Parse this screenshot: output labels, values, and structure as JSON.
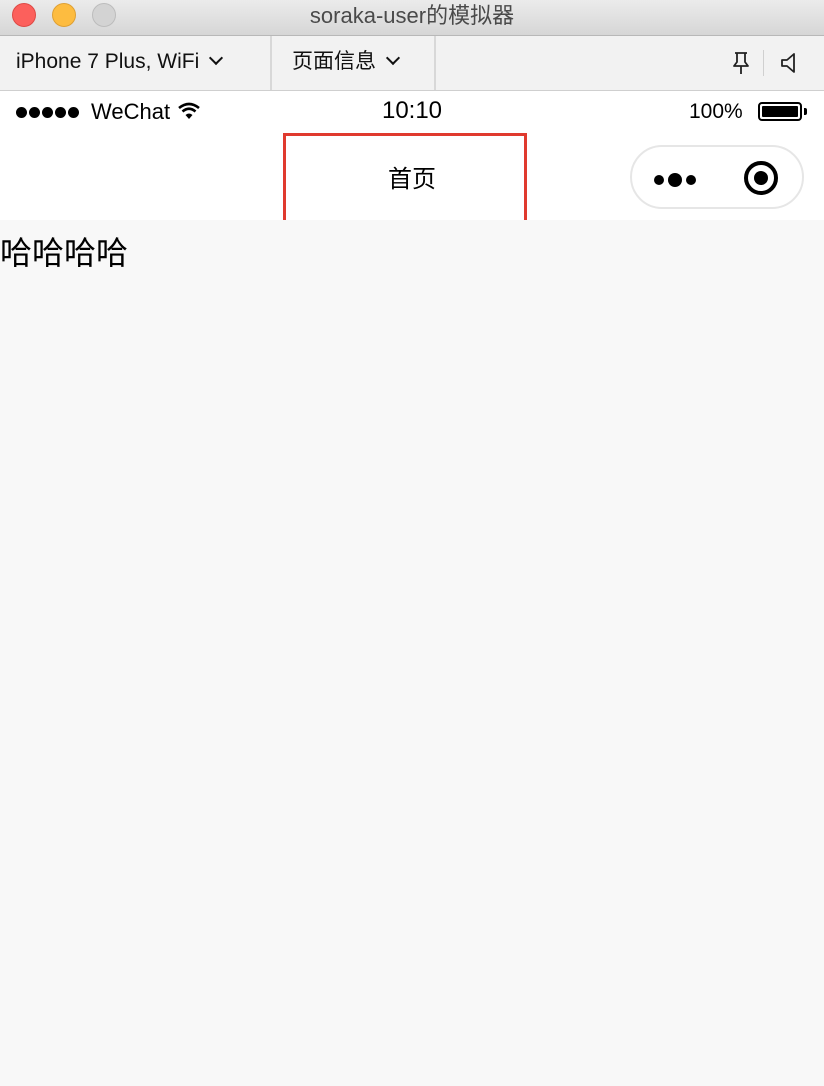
{
  "window": {
    "title": "soraka-user的模拟器"
  },
  "toolbar": {
    "device_label": "iPhone 7 Plus, WiFi",
    "page_info_label": "页面信息",
    "icons": [
      "pin-icon",
      "speaker-icon",
      "chevron-down-icon"
    ]
  },
  "statusbar": {
    "carrier": "WeChat",
    "time": "10:10",
    "battery": "100%",
    "signal_dots": 5,
    "battery_level": 1.0
  },
  "navbar": {
    "title": "首页",
    "highlight_color": "#e03a2f",
    "capsule_icons": [
      "more-dots-icon",
      "close-target-icon"
    ]
  },
  "page": {
    "text": "哈哈哈哈"
  },
  "colors": {
    "close": "#fc605c",
    "minimize": "#fdbc40",
    "maximize": "#d3d3d3",
    "page_background": "#f8f8f8"
  }
}
